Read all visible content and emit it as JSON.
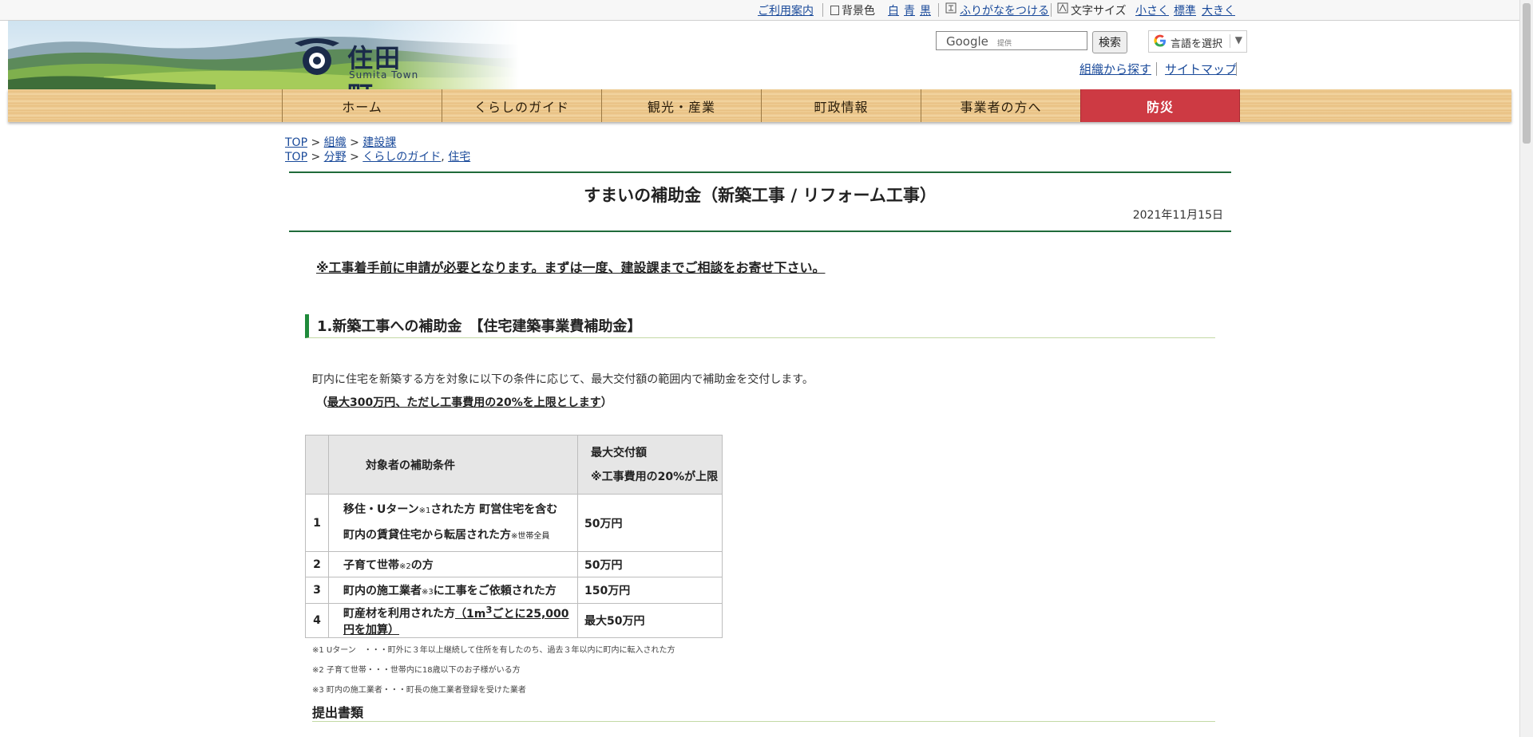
{
  "utility_bar": {
    "guide": "ご利用案内",
    "bg_color_label": "背景色",
    "bg_white": "白",
    "bg_blue": "青",
    "bg_black": "黒",
    "furigana": "ふりがなをつける",
    "font_size_label": "文字サイズ",
    "font_small": "小さく",
    "font_standard": "標準",
    "font_large": "大きく"
  },
  "header": {
    "logo_text": "住田町",
    "logo_sub": "Sumita Town",
    "search_brand": "Google",
    "search_brand_sub": "提供",
    "search_button": "検索",
    "language_select": "言語を選択",
    "find_by_org": "組織から探す",
    "sitemap": "サイトマップ"
  },
  "nav": {
    "items": [
      "ホーム",
      "くらしのガイド",
      "観光・産業",
      "町政情報",
      "事業者の方へ",
      "防災"
    ]
  },
  "breadcrumbs": {
    "row1": {
      "top": "TOP",
      "sep1": " > ",
      "org": "組織",
      "sep2": " > ",
      "dept": "建設課"
    },
    "row2": {
      "top": "TOP",
      "sep1": " > ",
      "field": "分野",
      "sep2": " > ",
      "guide": "くらしのガイド",
      "comma": ", ",
      "housing": "住宅"
    }
  },
  "article": {
    "title": "すまいの補助金（新築工事 / リフォーム工事）",
    "date": "2021年11月15日",
    "notice": "※工事着手前に申請が必要となります。まずは一度、建設課までご相談をお寄せ下さい。",
    "section1_heading": "1.新築工事への補助金　【住宅建築事業費補助金】",
    "intro_line1": "町内に住宅を新築する方を対象に以下の条件に応じて、最大交付額の範囲内で補助金を交付します。",
    "intro_line2_open": "（",
    "intro_line2_body": "最大300万円、ただし工事費用の20%を上限とします",
    "intro_line2_close": "）",
    "section2_heading": "提出書類"
  },
  "table": {
    "header_condition": "対象者の補助条件",
    "header_amount_line1": "最大交付額",
    "header_amount_line2": "※工事費用の20%が上限",
    "rows": [
      {
        "no": "1",
        "cond_a": "移住・Uターン",
        "cond_a_note": "※1",
        "cond_a_rest": "された方 町営住宅を含む",
        "cond_b": "町内の賃貸住宅から転居された方",
        "cond_b_note": "※世帯全員",
        "amount": "50万円"
      },
      {
        "no": "2",
        "cond": "子育て世帯",
        "cond_note": "※2",
        "cond_rest": "の方",
        "amount": "50万円"
      },
      {
        "no": "3",
        "cond": "町内の施工業者",
        "cond_note": "※3",
        "cond_rest": "に工事をご依頼された方",
        "amount": "150万円"
      },
      {
        "no": "4",
        "cond": "町産材を利用された方",
        "cond_extra_pre": "（1m",
        "cond_extra_sup": "3",
        "cond_extra_post": "ごとに25,000円を加算）",
        "amount": "最大50万円"
      }
    ]
  },
  "footnotes": [
    "※1 Uターン　・・・町外に３年以上継続して住所を有したのち、過去３年以内に町内に転入された方",
    "※2 子育て世帯・・・世帯内に18歳以下のお子様がいる方",
    "※3 町内の施工業者・・・町長の施工業者登録を受けた業者"
  ],
  "colors": {
    "accent_green": "#1f6b3a",
    "disaster_red": "#cd3a43",
    "link_blue": "#1a4a9a"
  }
}
